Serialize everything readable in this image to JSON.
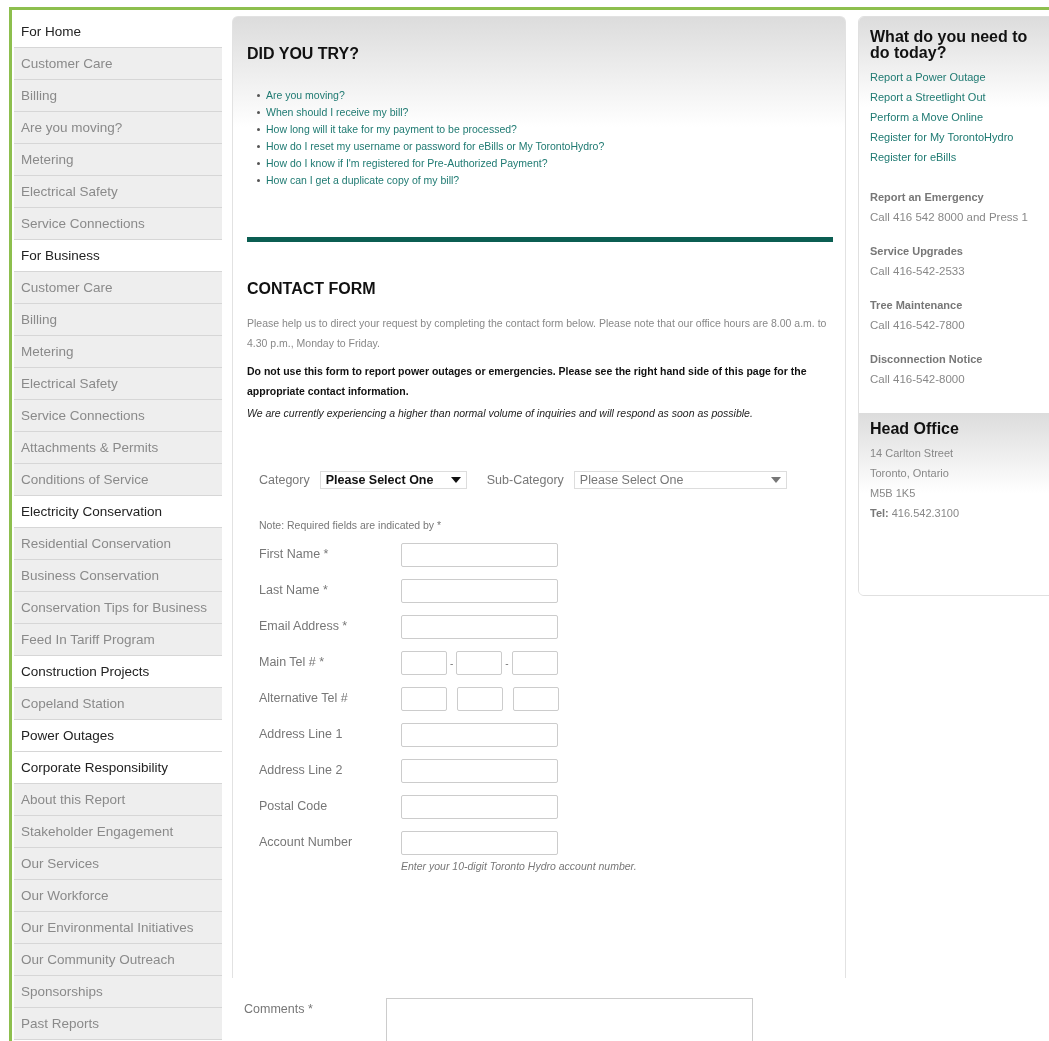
{
  "sidebar": {
    "items": [
      {
        "label": "For Home",
        "kind": "section"
      },
      {
        "label": "Customer Care",
        "kind": "link"
      },
      {
        "label": "Billing",
        "kind": "link"
      },
      {
        "label": "Are you moving?",
        "kind": "link"
      },
      {
        "label": "Metering",
        "kind": "link"
      },
      {
        "label": "Electrical Safety",
        "kind": "link"
      },
      {
        "label": "Service Connections",
        "kind": "link"
      },
      {
        "label": "For Business",
        "kind": "section"
      },
      {
        "label": "Customer Care",
        "kind": "link"
      },
      {
        "label": "Billing",
        "kind": "link"
      },
      {
        "label": "Metering",
        "kind": "link"
      },
      {
        "label": "Electrical Safety",
        "kind": "link"
      },
      {
        "label": "Service Connections",
        "kind": "link"
      },
      {
        "label": "Attachments & Permits",
        "kind": "link"
      },
      {
        "label": "Conditions of Service",
        "kind": "link"
      },
      {
        "label": "Electricity Conservation",
        "kind": "section"
      },
      {
        "label": "Residential Conservation",
        "kind": "link"
      },
      {
        "label": "Business Conservation",
        "kind": "link"
      },
      {
        "label": "Conservation Tips for Business",
        "kind": "link"
      },
      {
        "label": "Feed In Tariff Program",
        "kind": "link"
      },
      {
        "label": "Construction Projects",
        "kind": "section"
      },
      {
        "label": "Copeland Station",
        "kind": "link"
      },
      {
        "label": "Power Outages",
        "kind": "section"
      },
      {
        "label": "Corporate Responsibility",
        "kind": "section"
      },
      {
        "label": "About this Report",
        "kind": "link"
      },
      {
        "label": "Stakeholder Engagement",
        "kind": "link"
      },
      {
        "label": "Our Services",
        "kind": "link"
      },
      {
        "label": "Our Workforce",
        "kind": "link"
      },
      {
        "label": "Our Environmental Initiatives",
        "kind": "link"
      },
      {
        "label": "Our Community Outreach",
        "kind": "link"
      },
      {
        "label": "Sponsorships",
        "kind": "link"
      },
      {
        "label": "Past Reports",
        "kind": "link"
      }
    ]
  },
  "did_you_try": {
    "title": "DID YOU TRY?",
    "links": [
      "Are you moving?",
      "When should I receive my bill?",
      "How long will it take for my payment to be processed?",
      "How do I reset my username or password for eBills or My TorontoHydro?",
      "How do I know if I'm registered for Pre-Authorized Payment?",
      "How can I get a duplicate copy of my bill?"
    ]
  },
  "contact_form": {
    "title": "CONTACT FORM",
    "intro": "Please help us to direct your request by completing the contact form below. Please note that our office hours are 8.00 a.m. to 4.30 p.m., Monday to Friday.",
    "warning": "Do not use this form to report power outages or emergencies. Please see the right hand side of this page for the appropriate contact information.",
    "notice": "We are currently experiencing a higher than normal volume of inquiries and will respond as soon as possible.",
    "category": {
      "label": "Category",
      "value": "Please Select One"
    },
    "sub_category": {
      "label": "Sub-Category",
      "value": "Please Select One"
    },
    "required_note": "Note: Required fields are indicated by *",
    "fields": [
      {
        "label": "First Name *",
        "kind": "text"
      },
      {
        "label": "Last Name *",
        "kind": "text"
      },
      {
        "label": "Email Address *",
        "kind": "text"
      },
      {
        "label": "Main Tel # *",
        "kind": "phone",
        "separator": "-"
      },
      {
        "label": "Alternative Tel #",
        "kind": "phone"
      },
      {
        "label": "Address Line 1",
        "kind": "text"
      },
      {
        "label": "Address Line 2",
        "kind": "text"
      },
      {
        "label": "Postal Code",
        "kind": "text"
      },
      {
        "label": "Account Number",
        "kind": "text",
        "hint": "Enter your 10-digit Toronto Hydro account number."
      },
      {
        "label": "Comments *",
        "kind": "textarea"
      }
    ]
  },
  "quick_links": {
    "title": "What do you need to do today?",
    "links": [
      "Report a Power Outage",
      "Report a Streetlight Out",
      "Perform a Move Online",
      "Register for My TorontoHydro",
      "Register for eBills"
    ]
  },
  "contacts": [
    {
      "title": "Report an Emergency",
      "text": "Call 416 542 8000 and Press 1"
    },
    {
      "title": "Service Upgrades",
      "text": "Call 416-542-2533"
    },
    {
      "title": "Tree Maintenance",
      "text": "Call 416-542-7800"
    },
    {
      "title": "Disconnection Notice",
      "text": "Call 416-542-8000"
    }
  ],
  "head_office": {
    "title": "Head Office",
    "lines": [
      "14 Carlton Street",
      "Toronto, Ontario",
      "M5B 1K5"
    ],
    "tel_label": "Tel:",
    "tel": "416.542.3100"
  }
}
